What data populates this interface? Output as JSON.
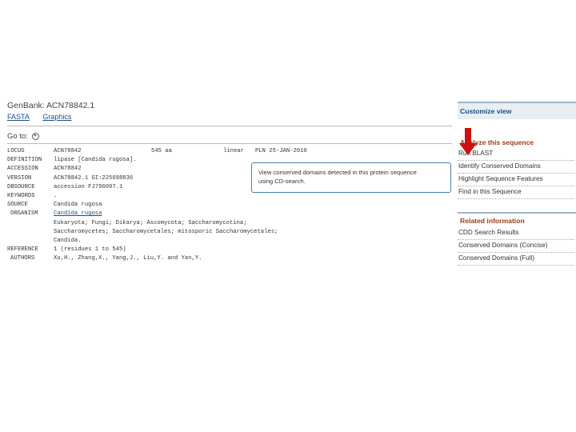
{
  "header": {
    "title": "GenBank: ACN78842.1",
    "links": [
      "FASTA",
      "Graphics"
    ]
  },
  "goto": {
    "label": "Go to:",
    "icon": "circle-down-icon"
  },
  "record": {
    "locus": {
      "key": "LOCUS",
      "name": "ACN78842",
      "length": "545 aa",
      "molecule": "linear",
      "date": "PLN 25-JAN-2010"
    },
    "definition": {
      "key": "DEFINITION",
      "value": "lipase [Candida rugosa]."
    },
    "accession": {
      "key": "ACCESSION",
      "value": "ACN78842"
    },
    "version": {
      "key": "VERSION",
      "value": "ACN78842.1  GI:225698836"
    },
    "dbsource": {
      "key": "DBSOURCE",
      "value": "accession FJ796097.1"
    },
    "keywords": {
      "key": "KEYWORDS",
      "value": "."
    },
    "source": {
      "key": "SOURCE",
      "value": "Candida rugosa"
    },
    "organism": {
      "key": "ORGANISM",
      "value": "Candida rugosa"
    },
    "lineage": [
      "Eukaryota; Fungi; Dikarya; Ascomycota; Saccharomycotina;",
      "Saccharomycetes; Saccharomycetales; mitosporic Saccharomycetales;",
      "Candida."
    ],
    "reference": {
      "key": "REFERENCE",
      "value": "1  (residues 1 to 545)"
    },
    "authors": {
      "key": "AUTHORS",
      "value": "Xu,H., Zhang,X., Yang,J., Liu,Y. and Yan,Y."
    }
  },
  "tooltip": {
    "line1": "View conserved domains detected in this protein sequence",
    "line2": "using CD-search."
  },
  "sidebar": {
    "customize": "Customize view",
    "analyze_title": "Analyze this sequence",
    "analyze_items": [
      "Run BLAST",
      "Identify Conserved Domains",
      "Highlight Sequence Features",
      "Find in this Sequence"
    ],
    "related_title": "Related information",
    "related_items": [
      "CDD Search Results",
      "Conserved Domains (Concise)",
      "Conserved Domains (Full)"
    ]
  },
  "colors": {
    "arrow": "#cc1111",
    "link": "#1a4f8a",
    "section_title": "#983b16",
    "tooltip_border": "#4a7fb0"
  }
}
